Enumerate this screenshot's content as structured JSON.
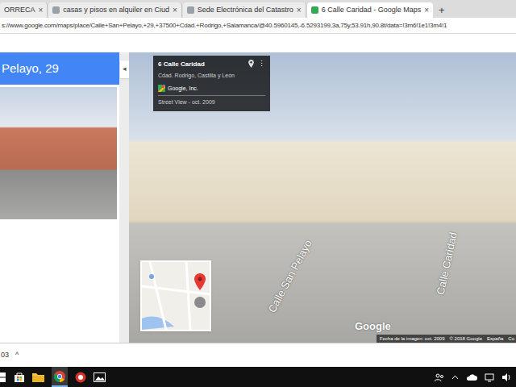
{
  "tabs": [
    {
      "label": "ORRECA",
      "selected": false
    },
    {
      "label": "casas y pisos en alquiler en Ciud",
      "selected": false
    },
    {
      "label": "Sede Electrónica del Catastro",
      "selected": false
    },
    {
      "label": "6 Calle Caridad - Google Maps",
      "selected": true
    }
  ],
  "tab_close": "×",
  "new_tab": "+",
  "address": "s://www.google.com/maps/place/Calle+San+Pelayo,+29,+37500+Cdad.+Rodrigo,+Salamanca/@40.5960145,-6.5293199,3a,75y,53.91h,90.8t/data=!3m6!1e1!3m4!1",
  "side_panel": {
    "title": "Pelayo, 29",
    "collapse": "◂"
  },
  "info_card": {
    "title": "6 Calle Caridad",
    "subtitle": "Cdad. Rodrigo, Castilla y León",
    "source": "Google, Inc.",
    "date": "Street View - oct. 2009",
    "menu": "⋮"
  },
  "street_labels": [
    "Calle San Pelayo",
    "Calle Caridad"
  ],
  "watermark": "Google",
  "footer": [
    "Fecha de la imagen: oct. 2009",
    "© 2018 Google",
    "España",
    "Co"
  ],
  "download_shelf": {
    "label": "03",
    "chevron": "^"
  }
}
